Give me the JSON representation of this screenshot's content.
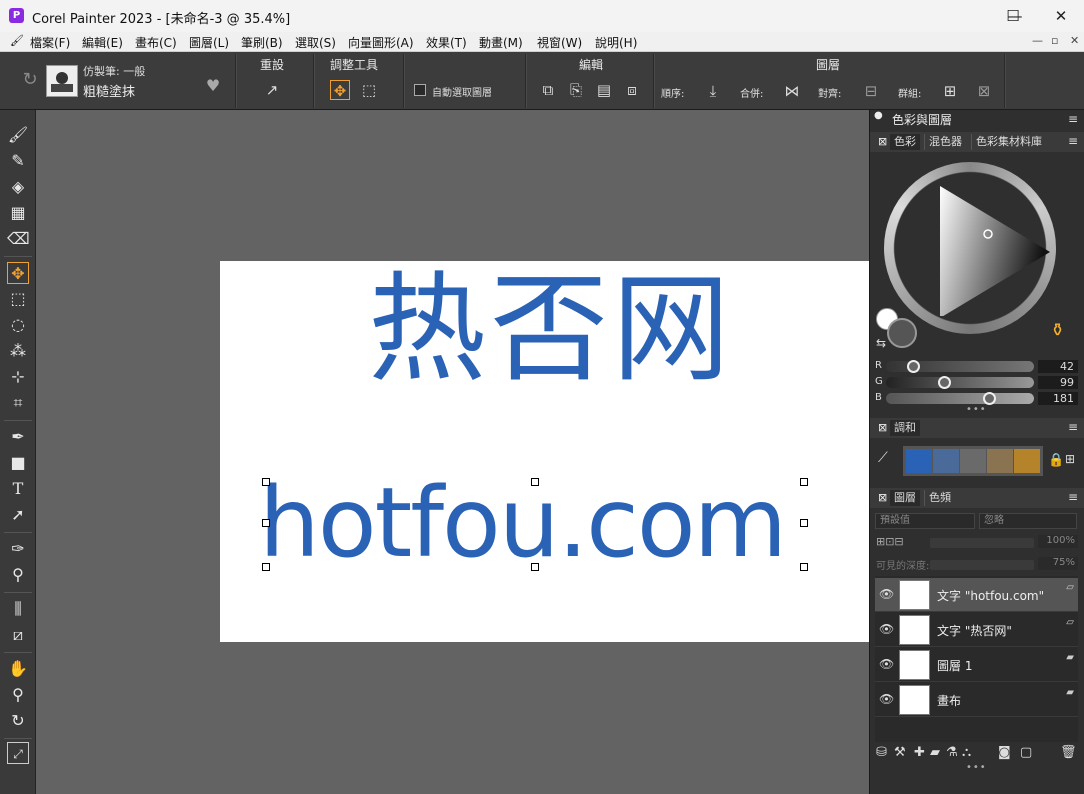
{
  "window": {
    "title": "Corel Painter 2023 - [未命名-3 @ 35.4%]",
    "app_icon": "P",
    "minimize_glyph": "—",
    "maximize_glyph": "☐",
    "close_glyph": "✕"
  },
  "menu": {
    "items": [
      "檔案(F)",
      "編輯(E)",
      "畫布(C)",
      "圖層(L)",
      "筆刷(B)",
      "選取(S)",
      "向量圖形(A)",
      "效果(T)",
      "動畫(M)",
      "視窗(W)",
      "說明(H)"
    ],
    "doc_controls": [
      "—",
      "▫",
      "✕"
    ]
  },
  "propbar": {
    "brush_category": "仿製筆: 一般",
    "brush_variant": "粗糙塗抹",
    "reset_label": "重設",
    "adjust_tool_label": "調整工具",
    "auto_select_label": "自動選取圖層",
    "edit_label": "編輯",
    "layer_label": "圖層",
    "order_label": "順序:",
    "merge_label": "合併:",
    "align_label": "對齊:",
    "group_label": "群組:"
  },
  "canvas": {
    "text_cn": "热否网",
    "text_url": "hotfou.com",
    "text_color": "#2a62b5"
  },
  "panel": {
    "title": "色彩與圖層",
    "color_tabs": [
      "色彩",
      "混色器",
      "色彩集材料庫"
    ],
    "rgb": {
      "r_label": "R",
      "g_label": "G",
      "b_label": "B",
      "r": "42",
      "g": "99",
      "b": "181"
    },
    "harmony_title": "調和",
    "harmony_swatches": [
      "#2a62b5",
      "#4a6a9a",
      "#6a6a6a",
      "#8a7350",
      "#b5832a"
    ],
    "layer_tabs": [
      "圖層",
      "色頻"
    ],
    "composite_method": "預設值",
    "composite_depth": "忽略",
    "opacity": "100%",
    "depth_label": "可見的深度:",
    "depth_value": "75%",
    "layers": [
      {
        "name": "文字 \"hotfou.com\"",
        "selected": true
      },
      {
        "name": "文字 \"热否网\"",
        "selected": false
      },
      {
        "name": "圖層 1",
        "selected": false
      },
      {
        "name": "畫布",
        "selected": false
      }
    ]
  }
}
